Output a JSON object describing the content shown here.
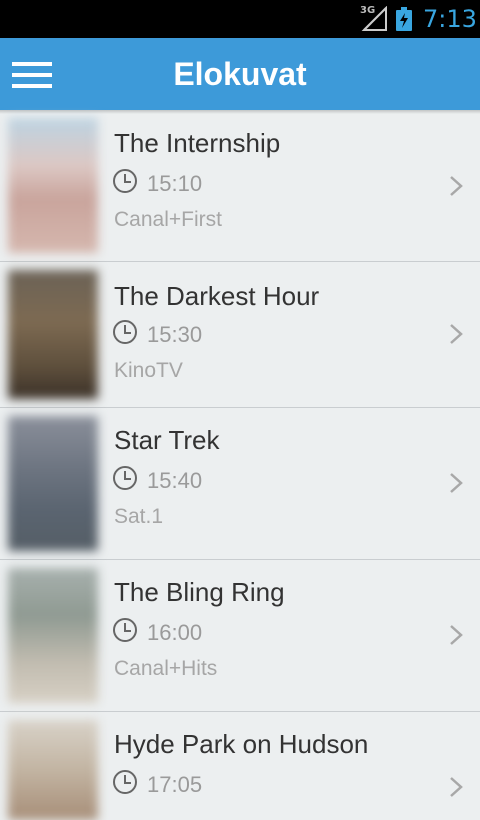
{
  "status_bar": {
    "network": "3G",
    "time": "7:13"
  },
  "app_bar": {
    "title": "Elokuvat",
    "menu_icon": "hamburger-menu-icon"
  },
  "colors": {
    "accent": "#3d9ad9",
    "status_time": "#39a6e0"
  },
  "movies": [
    {
      "title": "The Internship",
      "time": "15:10",
      "channel": "Canal+First"
    },
    {
      "title": "The Darkest Hour",
      "time": "15:30",
      "channel": "KinoTV"
    },
    {
      "title": "Star Trek",
      "time": "15:40",
      "channel": "Sat.1"
    },
    {
      "title": "The Bling Ring",
      "time": "16:00",
      "channel": "Canal+Hits"
    },
    {
      "title": "Hyde Park on Hudson",
      "time": "17:05",
      "channel": ""
    }
  ]
}
